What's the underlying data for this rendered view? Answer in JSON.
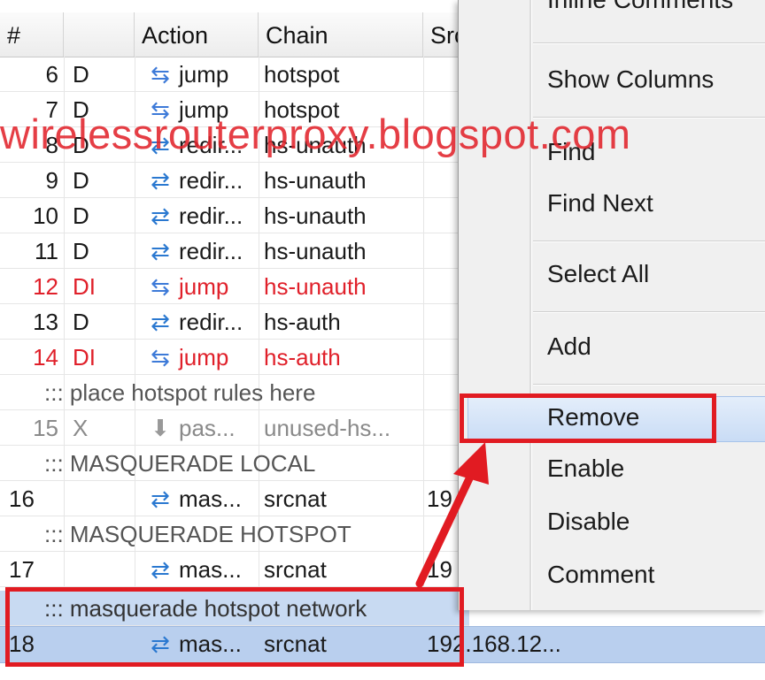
{
  "columns": [
    "#",
    "",
    "Action",
    "Chain",
    "Src"
  ],
  "rows": [
    {
      "num": "6",
      "flag": "D",
      "icon": "jump-icon",
      "action": "jump",
      "chain": "hotspot",
      "src": ""
    },
    {
      "num": "7",
      "flag": "D",
      "icon": "jump-icon",
      "action": "jump",
      "chain": "hotspot",
      "src": ""
    },
    {
      "num": "8",
      "flag": "D",
      "icon": "redirect-icon",
      "action": "redir...",
      "chain": "hs-unauth",
      "src": ""
    },
    {
      "num": "9",
      "flag": "D",
      "icon": "redirect-icon",
      "action": "redir...",
      "chain": "hs-unauth",
      "src": ""
    },
    {
      "num": "10",
      "flag": "D",
      "icon": "redirect-icon",
      "action": "redir...",
      "chain": "hs-unauth",
      "src": ""
    },
    {
      "num": "11",
      "flag": "D",
      "icon": "redirect-icon",
      "action": "redir...",
      "chain": "hs-unauth",
      "src": ""
    },
    {
      "num": "12",
      "flag": "DI",
      "icon": "jump-icon",
      "action": "jump",
      "chain": "hs-unauth",
      "src": ""
    },
    {
      "num": "13",
      "flag": "D",
      "icon": "redirect-icon",
      "action": "redir...",
      "chain": "hs-auth",
      "src": ""
    },
    {
      "num": "14",
      "flag": "DI",
      "icon": "jump-icon",
      "action": "jump",
      "chain": "hs-auth",
      "src": ""
    }
  ],
  "comment_place": "::: place hotspot rules here",
  "row15": {
    "num": "15",
    "flag": "X",
    "action": "pas...",
    "chain": "unused-hs...",
    "src": ""
  },
  "comment_local": "::: MASQUERADE LOCAL",
  "row16": {
    "num": "16",
    "action": "mas...",
    "chain": "srcnat",
    "src": "19"
  },
  "comment_hotspot": "::: MASQUERADE HOTSPOT",
  "row17": {
    "num": "17",
    "action": "mas...",
    "chain": "srcnat",
    "src": "19"
  },
  "comment_network": "::: masquerade hotspot network",
  "row18": {
    "num": "18",
    "action": "mas...",
    "chain": "srcnat",
    "src": "192.168.12..."
  },
  "menu": {
    "inline_comments": "Inline Comments",
    "show_columns": "Show Columns",
    "find": "Find",
    "find_next": "Find Next",
    "select_all": "Select All",
    "add": "Add",
    "remove": "Remove",
    "enable": "Enable",
    "disable": "Disable",
    "comment": "Comment"
  },
  "watermark": "wirelessrouterproxy.blogspot.com",
  "colors": {
    "annotation": "#e11b22",
    "disabled_row": "#e0202a",
    "selection": "#b9cfee"
  }
}
